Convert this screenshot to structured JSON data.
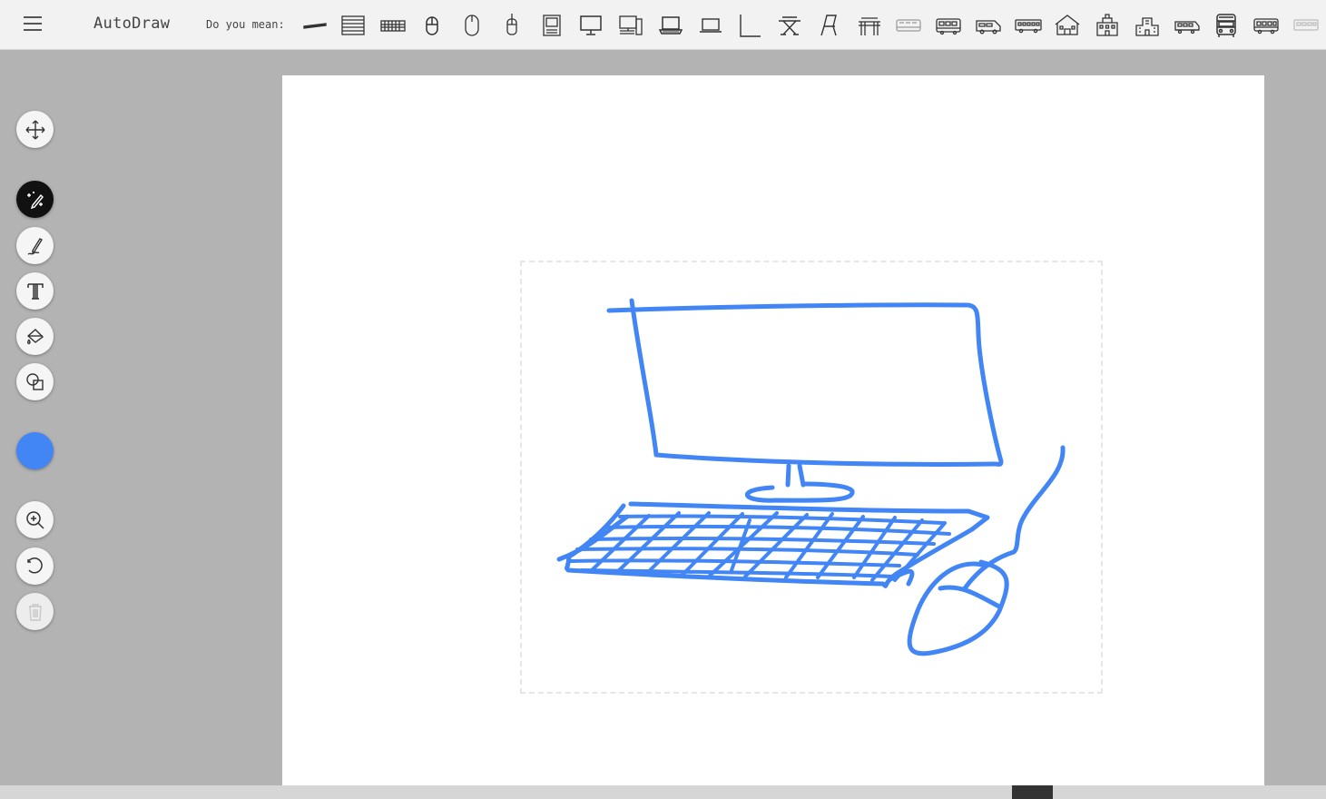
{
  "app": {
    "title": "AutoDraw"
  },
  "suggestions": {
    "label": "Do you mean:",
    "items": [
      {
        "name": "pen-suggestion-icon"
      },
      {
        "name": "keyboard-stack-suggestion-icon"
      },
      {
        "name": "keyboard-suggestion-icon"
      },
      {
        "name": "mouse-suggestion-icon"
      },
      {
        "name": "mouse-outline-suggestion-icon"
      },
      {
        "name": "mouse-small-suggestion-icon"
      },
      {
        "name": "computer-tower-suggestion-icon"
      },
      {
        "name": "monitor-suggestion-icon"
      },
      {
        "name": "desktop-computer-suggestion-icon"
      },
      {
        "name": "laptop-suggestion-icon"
      },
      {
        "name": "laptop-outline-suggestion-icon"
      },
      {
        "name": "corner-line-suggestion-icon"
      },
      {
        "name": "table-suggestion-icon"
      },
      {
        "name": "chair-suggestion-icon"
      },
      {
        "name": "desk-suggestion-icon"
      },
      {
        "name": "bus-light-suggestion-icon"
      },
      {
        "name": "bus-suggestion-icon"
      },
      {
        "name": "van-suggestion-icon"
      },
      {
        "name": "bus-long-suggestion-icon"
      },
      {
        "name": "house-suggestion-icon"
      },
      {
        "name": "school-suggestion-icon"
      },
      {
        "name": "building-suggestion-icon"
      },
      {
        "name": "train-suggestion-icon"
      },
      {
        "name": "bus-front-suggestion-icon"
      },
      {
        "name": "bus-side-suggestion-icon"
      },
      {
        "name": "bus-faded-suggestion-icon"
      }
    ]
  },
  "tools": {
    "move": "move-arrows-icon",
    "autodraw": "autodraw-magic-icon",
    "draw": "pencil-icon",
    "type": "text-icon",
    "fill": "paint-bucket-icon",
    "shape": "shapes-icon",
    "zoom": "zoom-in-icon",
    "undo": "undo-icon",
    "delete": "trash-icon"
  },
  "colors": {
    "current": "#4285f4",
    "stroke": "#4285f4",
    "selection": "#e6e6e6"
  }
}
